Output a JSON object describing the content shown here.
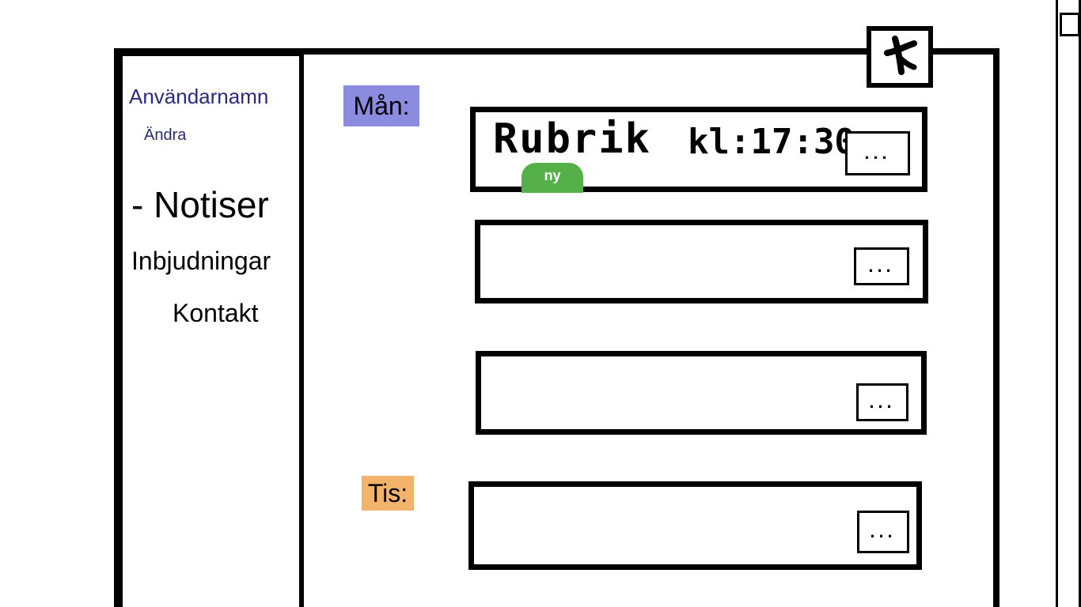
{
  "sidebar": {
    "username": "Användarnamn",
    "edit_label": "Ändra",
    "nav": {
      "notifications": "- Notiser",
      "invitations": "Inbjudningar",
      "contact": "Kontakt"
    }
  },
  "days": [
    {
      "label": "Mån:",
      "color": "#8b8be0"
    },
    {
      "label": "Tis:",
      "color": "#f2b46a"
    }
  ],
  "cards": [
    {
      "title": "Rubrik",
      "time": "kl:17:30",
      "badge": "ny",
      "badge_color": "#55b04a",
      "more_label": "..."
    },
    {
      "more_label": "..."
    },
    {
      "more_label": "..."
    },
    {
      "more_label": "..."
    }
  ],
  "icons": {
    "close": "close-icon"
  }
}
